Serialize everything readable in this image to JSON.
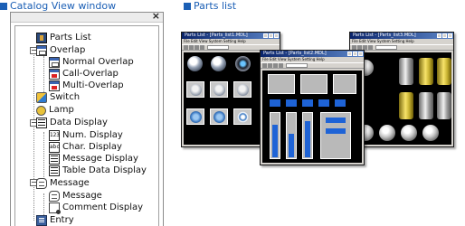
{
  "headings": {
    "catalog": "Catalog View window",
    "parts": "Parts list"
  },
  "catalog": {
    "close_symbol": "×",
    "tree": {
      "parts_list": "Parts List",
      "overlap": "Overlap",
      "normal_overlap": "Normal Overlap",
      "call_overlap": "Call-Overlap",
      "multi_overlap": "Multi-Overlap",
      "switch": "Switch",
      "lamp": "Lamp",
      "data_display": "Data Display",
      "num_display": "Num. Display",
      "char_display": "Char. Display",
      "message_display": "Message Display",
      "table_data_display": "Table Data Display",
      "message": "Message",
      "message_child": "Message",
      "comment_display": "Comment Display",
      "entry": "Entry"
    },
    "expander_symbol": "−",
    "num_icon_text": "123",
    "char_icon_text": "abc"
  },
  "parts_windows": {
    "title_1": "Parts List - [Parts_list1.MDL]",
    "title_2": "Parts List - [Parts_list2.MDL]",
    "title_3": "Parts List - [Parts_list3.MDL]",
    "menu": "File  Edit  View  System Setting  Help"
  }
}
